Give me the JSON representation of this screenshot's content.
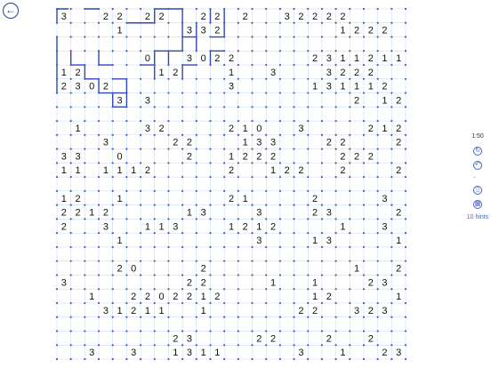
{
  "app": {
    "back_icon": "arrow-left-icon",
    "timer": "1:50",
    "controls": [
      {
        "name": "restart-button",
        "icon": "refresh-icon",
        "glyph": "↻"
      },
      {
        "name": "undo-button",
        "icon": "undo-icon",
        "glyph": "↶"
      },
      {
        "name": "separator",
        "icon": "dot-icon",
        "glyph": "·"
      },
      {
        "name": "erase-button",
        "icon": "eraser-icon",
        "glyph": "▯"
      },
      {
        "name": "mode-button",
        "icon": "grid-icon",
        "glyph": "▦"
      }
    ],
    "hints_label": "10 hints",
    "colors": {
      "grid": "#c9d6f0",
      "dot": "#3a5bd0",
      "line": "#2d46b8",
      "text": "#111111"
    }
  },
  "puzzle": {
    "rows": 25,
    "cols": 25,
    "clues": [
      "3  22 22  22 2  32222 ",
      "    1    332        1222 ",
      "      0  3022     2311211",
      "12     12   1  3   3222  ",
      "2302        3     131112 ",
      "    3 3              2 1221 1",
      " 1    32    210  3    212",
      "   3    22   133   22   2 ",
      "33  0    2  1222    222  2",
      "11 1112     2  122  2   21",
      "12  1       21    2    3   ",
      "2212     13   3   23    21  2",
      "2  3  113   1212    1  3 32",
      "    1         3   13    1 1",
      "    20    2          1  22   ",
      "3        22    1  1   23  201",
      "  1  2202212      12    10  ",
      "   31211  1      22  323    ",
      "        23    22   2  2  13  3",
      "  3  3  1311     3  1  23  3"
    ]
  }
}
